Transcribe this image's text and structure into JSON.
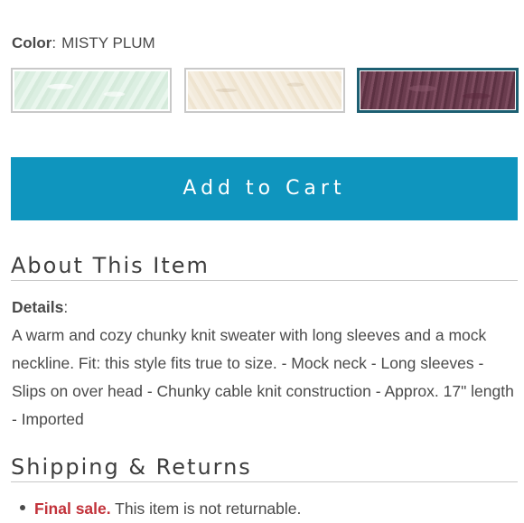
{
  "color": {
    "label": "Color",
    "separator": ":",
    "value": "MISTY PLUM",
    "swatches": [
      {
        "name": "mint",
        "hex": "#dcefe2",
        "selected": false
      },
      {
        "name": "cream",
        "hex": "#f3ebdc",
        "selected": false
      },
      {
        "name": "misty-plum",
        "hex": "#6a3c4e",
        "selected": true
      }
    ]
  },
  "cart": {
    "button_label": "Add to Cart",
    "color": "#0f95be"
  },
  "about": {
    "heading": "About This Item",
    "details_label": "Details",
    "details_separator": ":",
    "details_text": "A warm and cozy chunky knit sweater with long sleeves and a mock neckline. Fit: this style fits true to size. - Mock neck - Long sleeves - Slips on over head - Chunky cable knit construction - Approx. 17\" length - Imported"
  },
  "shipping": {
    "heading": "Shipping & Returns",
    "items": [
      {
        "highlight": "Final sale.",
        "text": " This item is not returnable.",
        "highlight_color": "#c2323a"
      }
    ]
  }
}
